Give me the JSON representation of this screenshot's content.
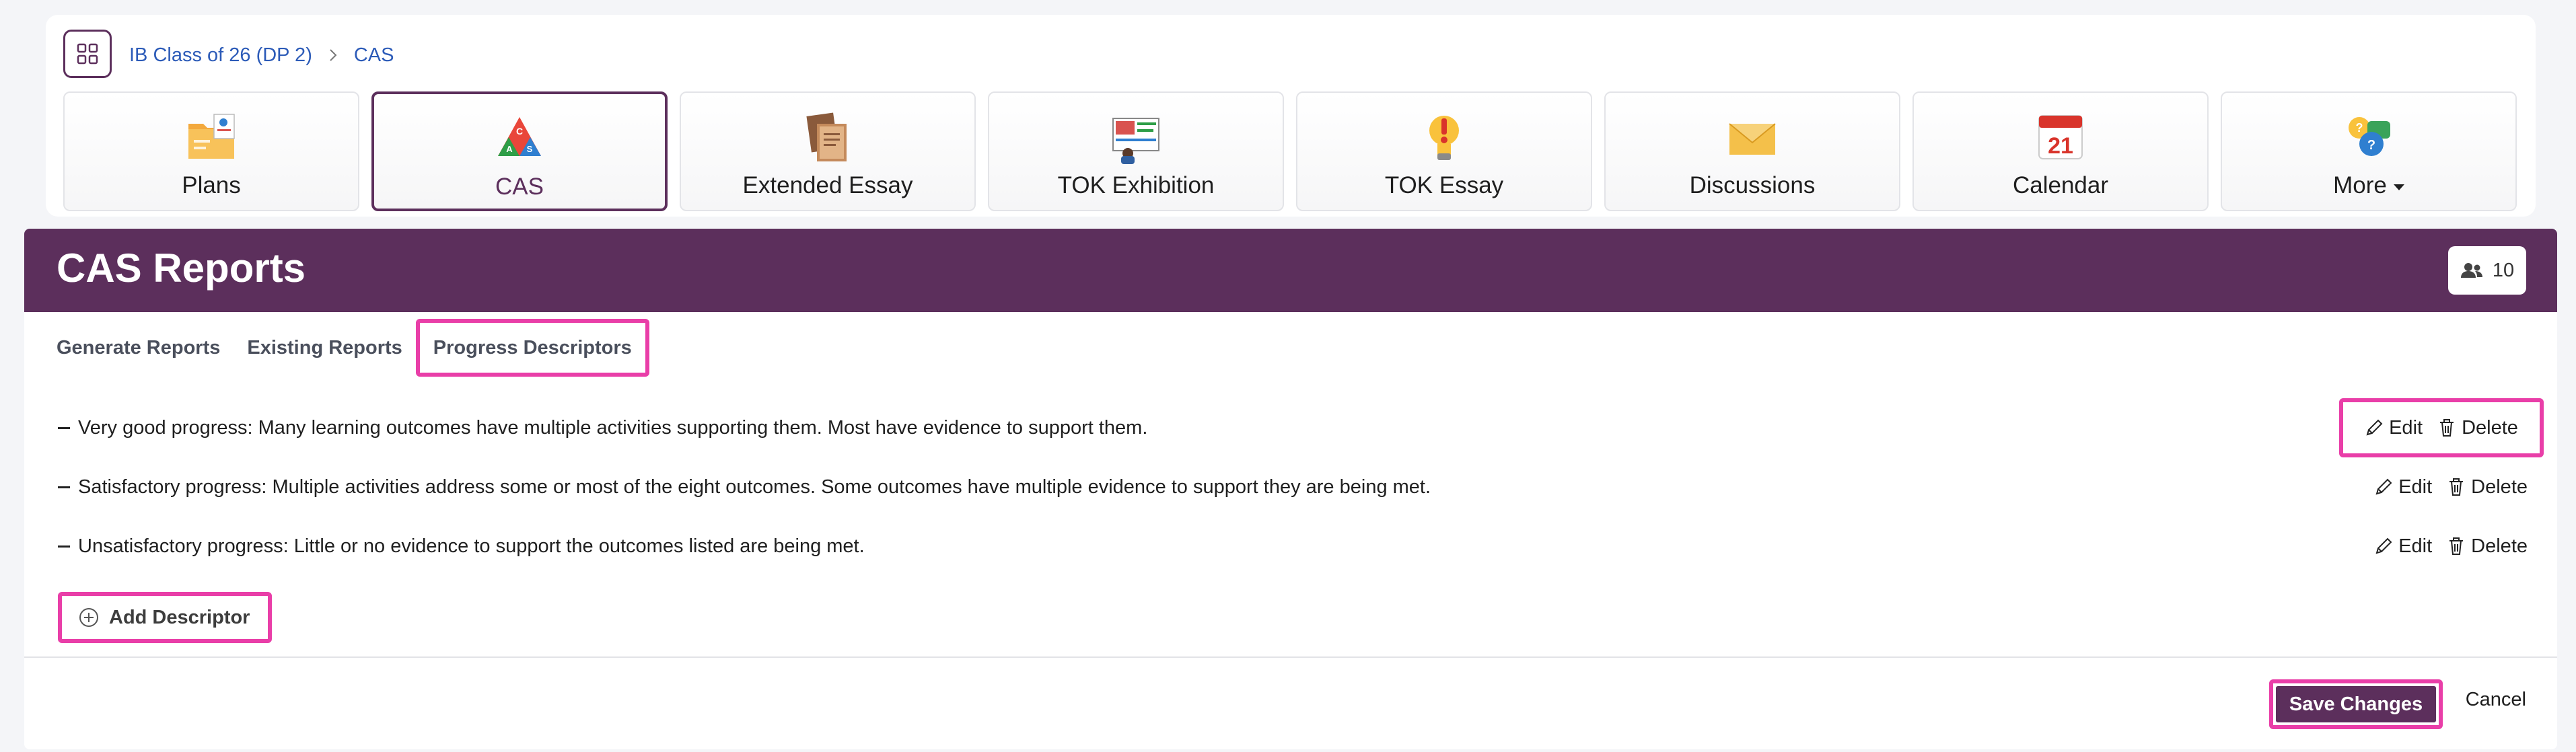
{
  "breadcrumb": {
    "class_name": "IB Class of 26 (DP 2)",
    "current": "CAS"
  },
  "nav_tiles": [
    {
      "label": "Plans",
      "icon": "plans-icon"
    },
    {
      "label": "CAS",
      "icon": "cas-icon",
      "active": true
    },
    {
      "label": "Extended Essay",
      "icon": "extended-essay-icon"
    },
    {
      "label": "TOK Exhibition",
      "icon": "tok-exhibition-icon"
    },
    {
      "label": "TOK Essay",
      "icon": "tok-essay-icon"
    },
    {
      "label": "Discussions",
      "icon": "discussions-icon"
    },
    {
      "label": "Calendar",
      "icon": "calendar-icon",
      "calendar_day": "21"
    },
    {
      "label": "More",
      "icon": "more-icon"
    }
  ],
  "panel": {
    "title": "CAS Reports",
    "member_count": "10",
    "tabs": [
      "Generate Reports",
      "Existing Reports",
      "Progress Descriptors"
    ],
    "active_tab": "Progress Descriptors"
  },
  "descriptors": [
    {
      "text": "Very good progress: Many learning outcomes have multiple activities supporting them. Most have evidence to support them."
    },
    {
      "text": "Satisfactory progress: Multiple activities address some or most of the eight outcomes. Some outcomes have multiple evidence to support they are being met."
    },
    {
      "text": "Unsatisfactory progress: Little or no evidence to support the outcomes listed are being met."
    }
  ],
  "actions": {
    "edit": "Edit",
    "delete": "Delete"
  },
  "add_descriptor_label": "Add Descriptor",
  "footer": {
    "save_label": "Save Changes",
    "cancel_label": "Cancel"
  },
  "colors": {
    "brand": "#5c2f5c",
    "highlight": "#e93ea8",
    "link": "#2c5bb8"
  }
}
